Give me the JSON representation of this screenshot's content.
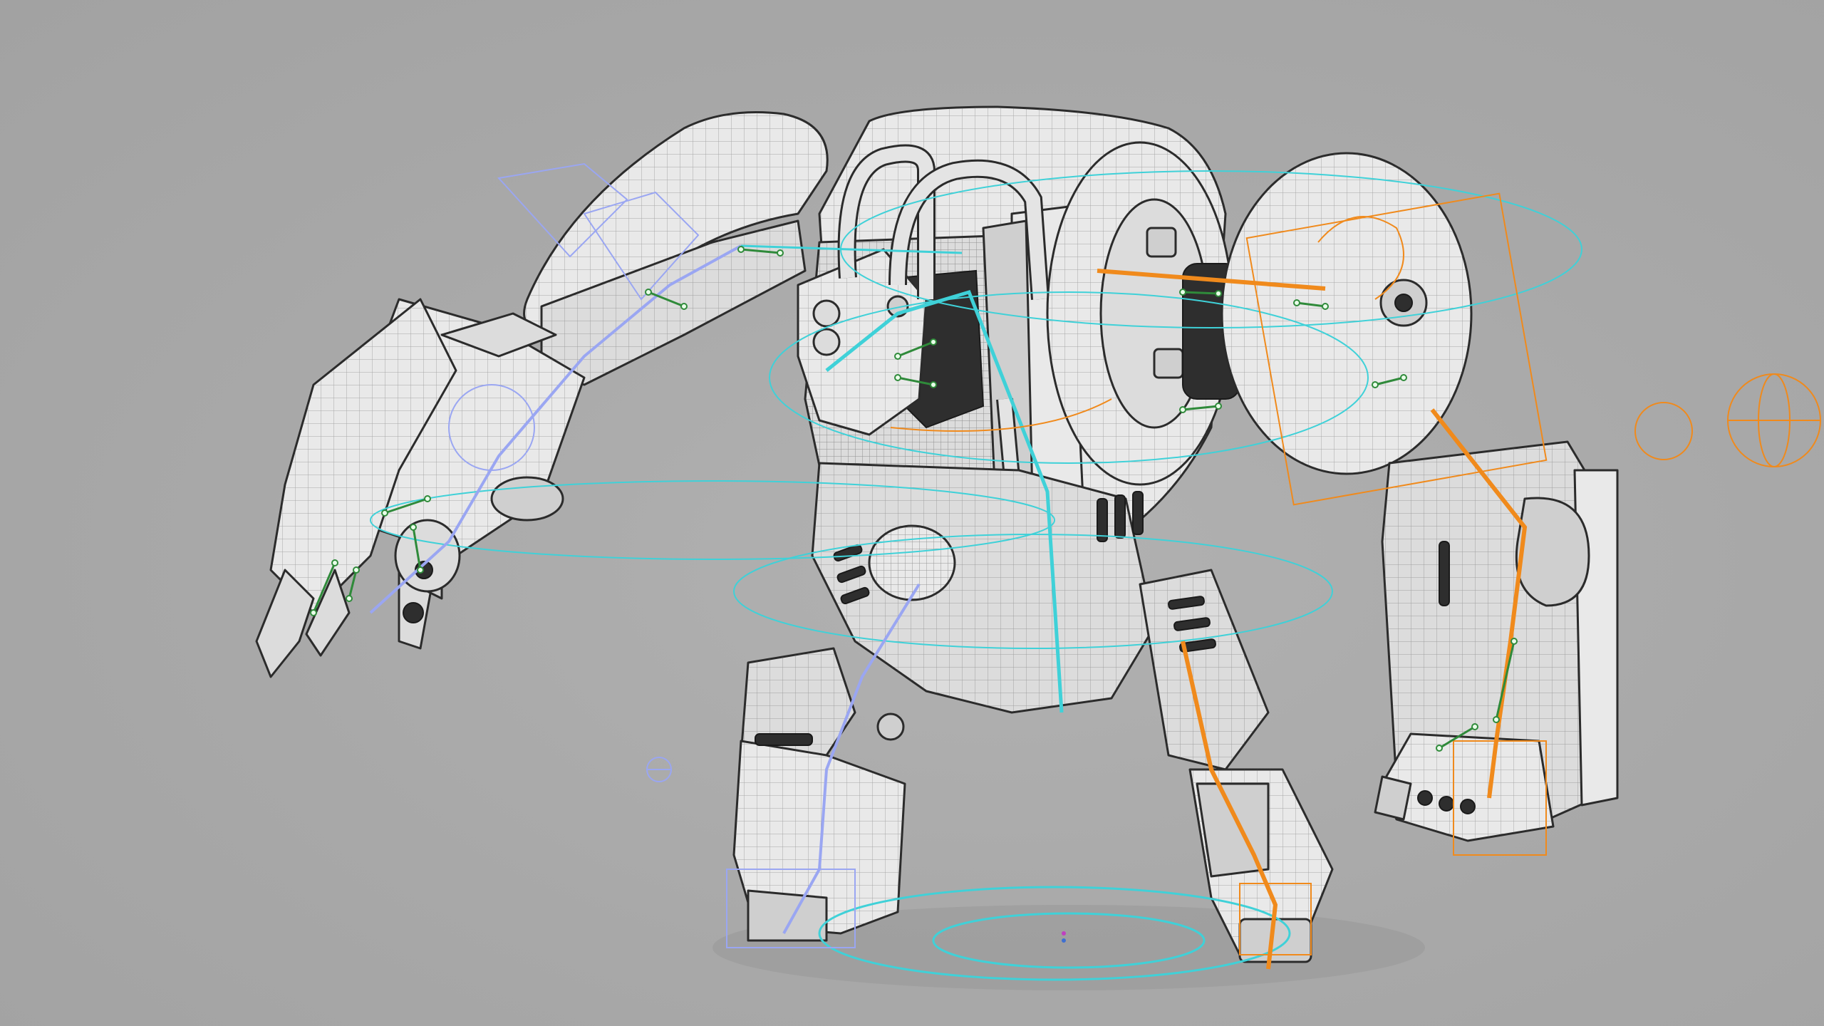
{
  "viewport": {
    "type": "3d-viewport",
    "shading": "wireframe-on-shaded",
    "background_color": "#a9a9a9"
  },
  "model": {
    "subject": "mech-robot",
    "mesh_color": "#e9e9e9",
    "wire_color": "#2b2b2b"
  },
  "rig": {
    "colors": {
      "center_controls": "#3fd1d8",
      "right_side_controls": "#f08a1c",
      "left_side_controls": "#9aa6f2",
      "joint_chains": "#2f8a3a"
    }
  }
}
